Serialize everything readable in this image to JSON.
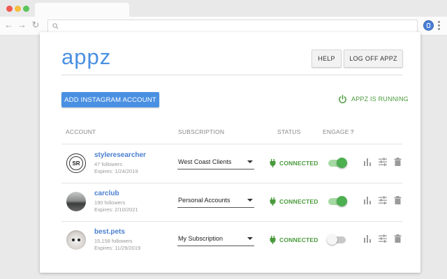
{
  "app": {
    "logo": "appz",
    "help_label": "HELP",
    "logoff_label": "LOG OFF APPZ",
    "add_account_label": "ADD INSTAGRAM ACCOUNT",
    "running_label": "APPZ IS RUNNING"
  },
  "table": {
    "headers": {
      "account": "ACCOUNT",
      "subscription": "SUBSCRIPTION",
      "status": "STATUS",
      "engage": "ENGAGE",
      "engage_help": "?"
    },
    "rows": [
      {
        "name": "styleresearcher",
        "avatar_text": "SR",
        "followers": "47 followers",
        "expires": "Expires: 1/24/2019",
        "subscription": "West Coast Clients",
        "status": "CONNECTED",
        "engage_on": true
      },
      {
        "name": "carclub",
        "followers": "190 followers",
        "expires": "Expires: 2/10/2021",
        "subscription": "Personal Accounts",
        "status": "CONNECTED",
        "engage_on": true
      },
      {
        "name": "best.pets",
        "followers": "15,158 followers",
        "expires": "Expires: 11/29/2019",
        "subscription": "My Subscription",
        "status": "CONNECTED",
        "engage_on": false
      }
    ]
  },
  "icons": {
    "browser": [
      "back-icon",
      "forward-icon",
      "reload-icon",
      "search-icon",
      "extension-icon",
      "menu-icon"
    ],
    "row_actions": [
      "bar-chart-icon",
      "tune-icon",
      "trash-icon"
    ],
    "status": "plug-icon",
    "running": "power-icon"
  },
  "colors": {
    "brand": "#4a90e2",
    "connected": "#4a9a3c",
    "toggle_on": "#4caf50"
  }
}
